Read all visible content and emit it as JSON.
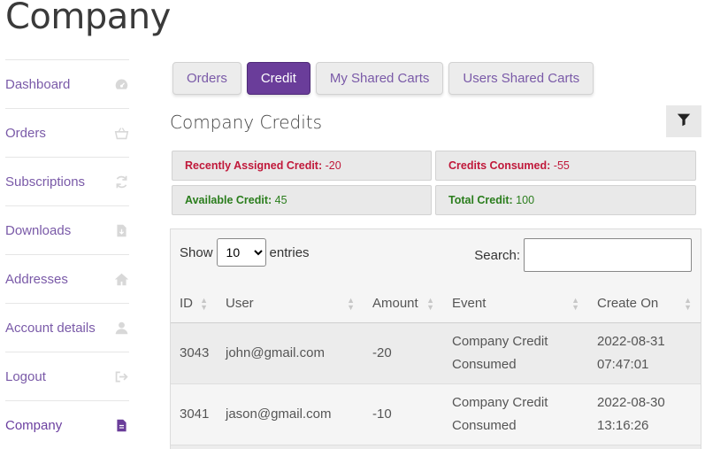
{
  "page": {
    "title": "Company"
  },
  "sidebar": {
    "items": [
      {
        "label": "Dashboard",
        "icon": "dashboard-icon"
      },
      {
        "label": "Orders",
        "icon": "basket-icon"
      },
      {
        "label": "Subscriptions",
        "icon": "refresh-icon"
      },
      {
        "label": "Downloads",
        "icon": "file-download-icon"
      },
      {
        "label": "Addresses",
        "icon": "home-icon"
      },
      {
        "label": "Account details",
        "icon": "user-icon"
      },
      {
        "label": "Logout",
        "icon": "sign-out-icon"
      },
      {
        "label": "Company",
        "icon": "document-icon",
        "active": true
      }
    ]
  },
  "tabs": [
    {
      "label": "Orders"
    },
    {
      "label": "Credit",
      "active": true
    },
    {
      "label": "My Shared Carts"
    },
    {
      "label": "Users Shared Carts"
    }
  ],
  "section": {
    "title": "Company Credits",
    "filter_icon": "filter-icon"
  },
  "credits": {
    "recent_label": "Recently Assigned Credit:",
    "recent_value": "-20",
    "consumed_label": "Credits Consumed:",
    "consumed_value": "-55",
    "available_label": "Available Credit:",
    "available_value": "45",
    "total_label": "Total Credit:",
    "total_value": "100"
  },
  "table": {
    "show_label": "Show",
    "entries_label": "entries",
    "page_length": "10",
    "search_label": "Search:",
    "search_value": "",
    "columns": [
      "ID",
      "User",
      "Amount",
      "Event",
      "Create On"
    ],
    "rows": [
      {
        "id": "3043",
        "user": "john@gmail.com",
        "amount": "-20",
        "event_1": "Company Credit",
        "event_2": "Consumed",
        "date": "2022-08-31",
        "time": "07:47:01"
      },
      {
        "id": "3041",
        "user": "jason@gmail.com",
        "amount": "-10",
        "event_1": "Company Credit",
        "event_2": "Consumed",
        "date": "2022-08-30",
        "time": "13:16:26"
      }
    ]
  },
  "colors": {
    "accent": "#6a3d9a",
    "link": "#7a5aa8",
    "negative": "#c0183a",
    "positive": "#2a7d1c"
  }
}
